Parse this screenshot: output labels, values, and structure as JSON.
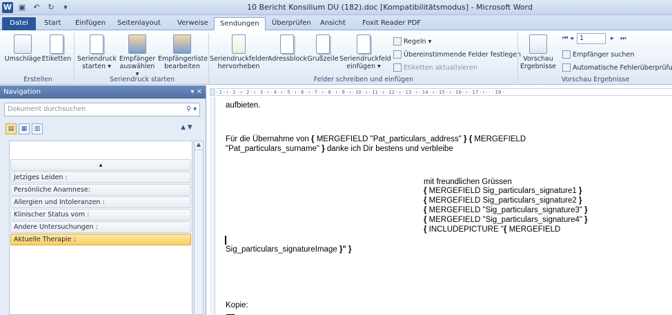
{
  "titlebar": {
    "app_icon": "W",
    "title": "10 Bericht Konsilium DU (182).doc [Kompatibilitätsmodus] - Microsoft Word",
    "qat_icons": [
      "save-icon",
      "undo-icon",
      "redo-icon",
      "customize-icon"
    ]
  },
  "tabs": {
    "file": "Datei",
    "items": [
      "Start",
      "Einfügen",
      "Seitenlayout",
      "Verweise",
      "Sendungen",
      "Überprüfen",
      "Ansicht",
      "Foxit Reader PDF"
    ],
    "active": "Sendungen"
  },
  "ribbon": {
    "erstellen": {
      "label": "Erstellen",
      "umschlaege": "Umschläge",
      "etiketten": "Etiketten"
    },
    "seriendruck": {
      "label": "Seriendruck starten",
      "start": [
        "Seriendruck",
        "starten ▾"
      ],
      "auswaehlen": [
        "Empfänger",
        "auswählen ▾"
      ],
      "bearbeiten": [
        "Empfängerliste",
        "bearbeiten"
      ]
    },
    "felder": {
      "label": "Felder schreiben und einfügen",
      "hervorheben": [
        "Seriendruckfelder",
        "hervorheben"
      ],
      "adressblock": "Adressblock",
      "grusszeile": "Grußzeile",
      "einfuegen": [
        "Seriendruckfeld",
        "einfügen ▾"
      ],
      "regeln": "Regeln ▾",
      "festlegen": "Übereinstimmende Felder festlegen",
      "aktualisieren": "Etiketten aktualisieren"
    },
    "vorschau": {
      "label": "Vorschau Ergebnisse",
      "vorschau_btn": [
        "Vorschau",
        "Ergebnisse"
      ],
      "record_value": "1",
      "suchen": "Empfänger suchen",
      "fehler": "Automatische Fehlerüberprüfung"
    }
  },
  "navigation": {
    "title": "Navigation",
    "search_placeholder": "Dokument durchsuchen",
    "headings": [
      {
        "label": "Jetziges Leiden :",
        "selected": false
      },
      {
        "label": "Persönliche Anamnese:",
        "selected": false
      },
      {
        "label": "Allergien und Intoleranzen :",
        "selected": false
      },
      {
        "label": "Klinischer Status vom :",
        "selected": false
      },
      {
        "label": "Andere Untersuchungen :",
        "selected": false
      },
      {
        "label": "Aktuelle Therapie :",
        "selected": true
      }
    ]
  },
  "ruler": {
    "ticks": "· 1 · ı · 1 · ı · 2 · ı · 3 · ı · 4 · ı · 5 · ı · 6 · ı · 7 · ı · 8 · ı · 9 · ı · 10 · ı · 11 · ı · 12 · ı · 13 · ı · 14 · ı · 15 · ı · 16 · ı · 17 · ı · · · 19 ·"
  },
  "document": {
    "line1": "aufbieten.",
    "line2a": "Für die Übernahme von ",
    "line2b": "{ ",
    "line2c": "MERGEFIELD \"Pat_particulars_address\" ",
    "line2d": "} { ",
    "line2e": "MERGEFIELD",
    "line3a": "\"Pat_particulars_surname\" ",
    "line3b": "}",
    "line3c": " danke ich Dir bestens und verbleibe",
    "greeting": "mit freundlichen Grüssen",
    "sig1": "MERGEFIELD Sig_particulars_signature1 ",
    "sig2": "MERGEFIELD Sig_particulars_signature2 ",
    "sig3": "MERGEFIELD \"Sig_particulars_signature3\" ",
    "sig4": "MERGEFIELD \"Sig_particulars_signature4\" ",
    "sig5a": "INCLUDEPICTURE \"",
    "sig5b": "{ ",
    "sig5c": "MERGEFIELD",
    "sigimg": "Sig_particulars_signatureImage ",
    "sigimg_end": "}\" }",
    "open_brace": "{ ",
    "close_brace": "}",
    "kopie": "Kopie:"
  }
}
